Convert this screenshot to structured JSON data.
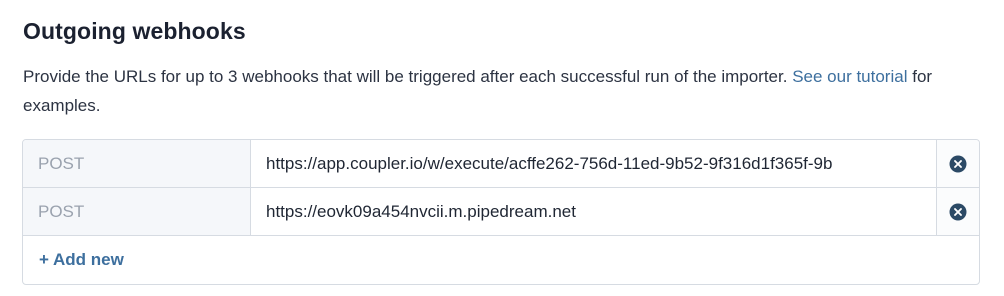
{
  "section": {
    "title": "Outgoing webhooks",
    "description_text": "Provide the URLs for up to 3 webhooks that will be triggered after each successful run of the importer.",
    "tutorial_link": "See our tutorial",
    "description_suffix": "for examples."
  },
  "webhooks": [
    {
      "method": "POST",
      "url": "https://app.coupler.io/w/execute/acffe262-756d-11ed-9b52-9f316d1f365f-9b",
      "remove_icon": "close-circle-icon"
    },
    {
      "method": "POST",
      "url": "https://eovk09a454nvcii.m.pipedream.net",
      "remove_icon": "close-circle-icon"
    }
  ],
  "actions": {
    "add_new_label": "+ Add new"
  },
  "colors": {
    "link": "#3d6f9e",
    "remove_icon": "#2c4a66",
    "border": "#d6dbe2",
    "method_bg": "#f5f7fa"
  }
}
